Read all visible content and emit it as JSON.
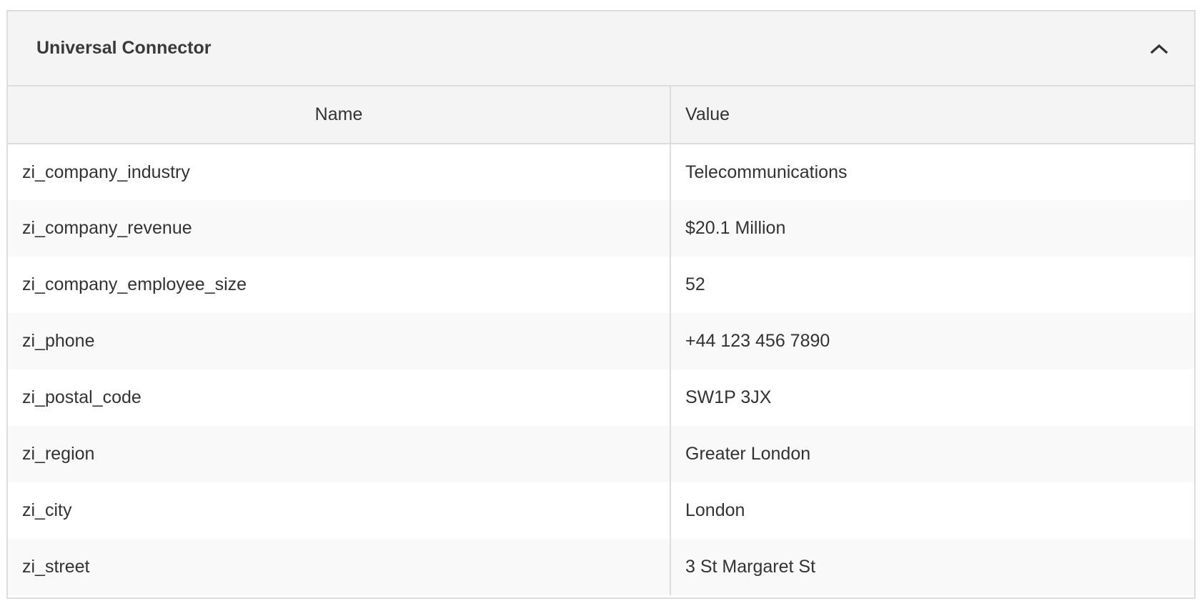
{
  "panel": {
    "title": "Universal Connector",
    "toggle_icon": "chevron-up-icon"
  },
  "table": {
    "headers": {
      "name": "Name",
      "value": "Value"
    },
    "rows": [
      {
        "name": "zi_company_industry",
        "value": "Telecommunications"
      },
      {
        "name": "zi_company_revenue",
        "value": "$20.1 Million"
      },
      {
        "name": "zi_company_employee_size",
        "value": "52"
      },
      {
        "name": "zi_phone",
        "value": "+44 123 456 7890"
      },
      {
        "name": "zi_postal_code",
        "value": "SW1P 3JX"
      },
      {
        "name": "zi_region",
        "value": "Greater London"
      },
      {
        "name": "zi_city",
        "value": "London"
      },
      {
        "name": "zi_street",
        "value": "3 St Margaret St"
      }
    ]
  }
}
